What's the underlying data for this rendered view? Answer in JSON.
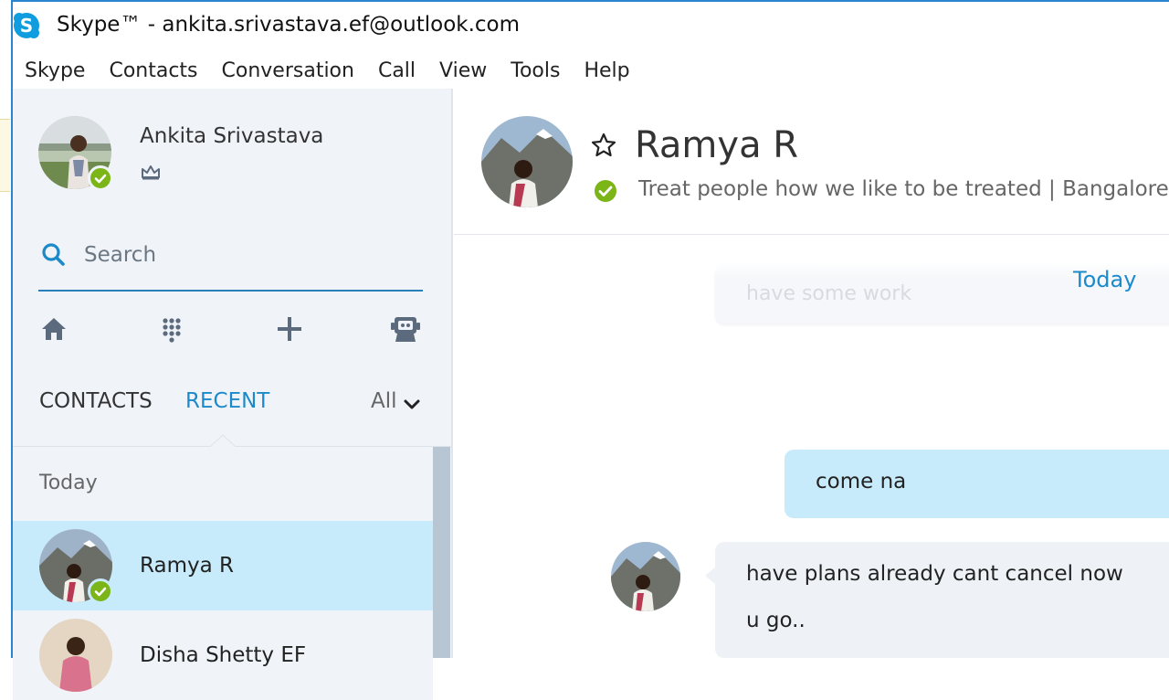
{
  "window": {
    "title": "Skype™ - ankita.srivastava.ef@outlook.com",
    "accent": "#2b84d0"
  },
  "menu": [
    "Skype",
    "Contacts",
    "Conversation",
    "Call",
    "View",
    "Tools",
    "Help"
  ],
  "profile": {
    "name": "Ankita Srivastava",
    "status": "online",
    "status_color": "#7cb518",
    "badge_icon": "crown-icon"
  },
  "search": {
    "placeholder": "Search",
    "value": ""
  },
  "toolbar": {
    "icons": [
      "home-icon",
      "dialpad-icon",
      "add-icon",
      "bot-icon"
    ]
  },
  "tabs": {
    "contacts": "CONTACTS",
    "recent": "RECENT",
    "active": "recent",
    "filter": "All"
  },
  "recent_list": {
    "section": "Today",
    "items": [
      {
        "name": "Ramya R",
        "selected": true,
        "status": "online"
      },
      {
        "name": "Disha Shetty EF",
        "selected": false
      }
    ]
  },
  "conversation": {
    "contact_name": "Ramya R",
    "mood": "Treat people how we like to be treated  |  Bangalore, In",
    "favorite_icon": "star-icon",
    "status": "online",
    "day_label": "Today",
    "messages": [
      {
        "direction": "in",
        "text": "have some work",
        "faded": true
      },
      {
        "direction": "out",
        "text": "come na"
      },
      {
        "direction": "in",
        "lines": [
          "have plans already cant cancel now",
          "u go.."
        ]
      }
    ]
  }
}
